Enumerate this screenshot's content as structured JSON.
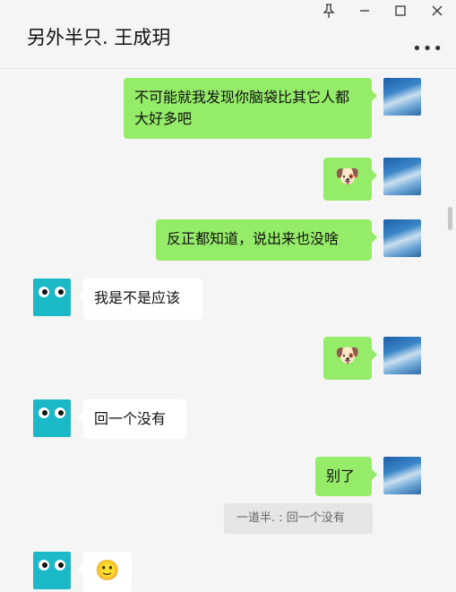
{
  "header": {
    "title": "另外半只. 王成玥",
    "pin_icon": "pin-icon",
    "minimize_icon": "minimize-icon",
    "maximize_icon": "maximize-icon",
    "close_icon": "close-icon",
    "more_icon": "more-icon"
  },
  "messages": [
    {
      "from": "me",
      "text": "不可能就我发现你脑袋比其它人都大好多吧"
    },
    {
      "from": "me",
      "text": "🐶"
    },
    {
      "from": "me",
      "text": "反正都知道，说出来也没啥"
    },
    {
      "from": "other",
      "text": "我是不是应该"
    },
    {
      "from": "me",
      "text": "🐶"
    },
    {
      "from": "other",
      "text": "回一个没有"
    },
    {
      "from": "me",
      "text": "别了"
    },
    {
      "from": "me_quote",
      "text": "一道半. : 回一个没有"
    },
    {
      "from": "other",
      "text": "🙂"
    }
  ],
  "colors": {
    "out_bubble": "#95ec69",
    "in_bubble": "#ffffff",
    "background": "#f5f5f5",
    "other_avatar": "#1bb9c8"
  }
}
